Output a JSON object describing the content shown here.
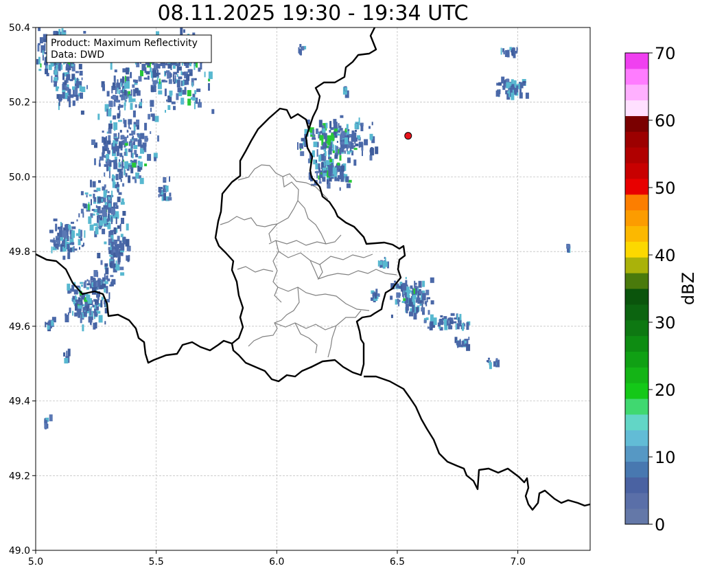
{
  "title": "08.11.2025 19:30 - 19:34 UTC",
  "info_box": {
    "product_line": "Product: Maximum Reflectivity",
    "data_line": "Data: DWD"
  },
  "axes": {
    "lon_range": [
      5.0,
      7.3
    ],
    "lat_range": [
      49.0,
      50.4
    ],
    "lon_ticks": [
      "5.0",
      "5.5",
      "6.0",
      "6.5",
      "7.0"
    ],
    "lat_ticks": [
      "49.0",
      "49.2",
      "49.4",
      "49.6",
      "49.8",
      "50.0",
      "50.2",
      "50.4"
    ],
    "grid": true
  },
  "marker": {
    "lon": 6.545,
    "lat": 50.11,
    "color": "#e8141c"
  },
  "colorbar": {
    "label": "dBZ",
    "ticks": [
      "0",
      "10",
      "20",
      "30",
      "40",
      "50",
      "60",
      "70"
    ],
    "range": [
      0,
      70
    ],
    "colors": [
      "#6478a8",
      "#5a6fa8",
      "#4a62a2",
      "#4878b0",
      "#5698c4",
      "#62bcd6",
      "#62d6c6",
      "#40d870",
      "#14c818",
      "#14b416",
      "#10a014",
      "#0e8c12",
      "#0e7812",
      "#0c6410",
      "#0a540c",
      "#4a7a0c",
      "#aab20a",
      "#fcd800",
      "#fcb800",
      "#fc9c00",
      "#fc7e00",
      "#e80000",
      "#c80000",
      "#b00000",
      "#9c0000",
      "#7a0000",
      "#ffe0ff",
      "#ffb0ff",
      "#ff7cff",
      "#f040f0"
    ]
  },
  "colors": {
    "border_national": "#000000",
    "border_internal": "#808080",
    "echo_weak": "#4a68a8",
    "echo_mid": "#58b8d0",
    "echo_strong": "#28c838"
  }
}
